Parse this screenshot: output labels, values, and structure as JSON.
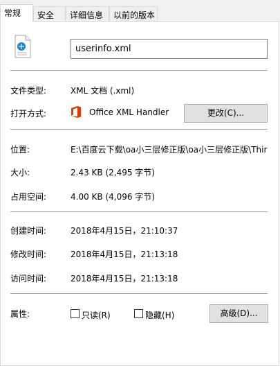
{
  "tabs": [
    "常规",
    "安全",
    "详细信息",
    "以前的版本"
  ],
  "file_name": "userinfo.xml",
  "labels": {
    "type": "文件类型:",
    "opens_with": "打开方式:",
    "location": "位置:",
    "size": "大小:",
    "size_on_disk": "占用空间:",
    "created": "创建时间:",
    "modified": "修改时间:",
    "accessed": "访问时间:",
    "attributes": "属性:"
  },
  "values": {
    "type": "XML 文档 (.xml)",
    "opens_with_app": "Office XML Handler",
    "location": "E:\\百度云下载\\oa小三层修正版\\oa小三层修正版\\Thir",
    "size": "2.43 KB (2,495 字节)",
    "size_on_disk": "4.00 KB (4,096 字节)",
    "created": "2018年4月15日，21:10:37",
    "modified": "2018年4月15日，21:13:18",
    "accessed": "2018年4月15日，21:13:18"
  },
  "buttons": {
    "change": "更改(C)...",
    "advanced": "高级(D)..."
  },
  "attributes": {
    "readonly": "只读(R)",
    "hidden": "隐藏(H)",
    "readonly_checked": false,
    "hidden_checked": false
  },
  "colors": {
    "office_orange": "#d83b01",
    "xml_icon_blue": "#1e88c7"
  }
}
